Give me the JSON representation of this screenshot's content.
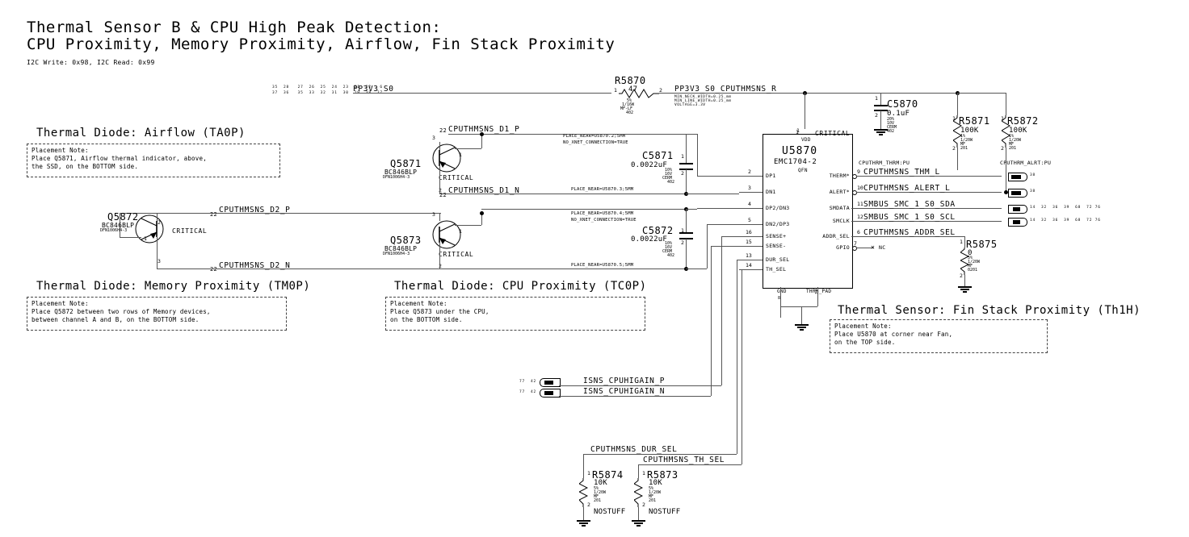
{
  "sheet": {
    "title_line1": "Thermal Sensor B & CPU High Peak Detection:",
    "title_line2": "CPU Proximity, Memory Proximity, Airflow, Fin Stack Proximity",
    "subtitle": "I2C Write: 0x98, I2C Read: 0x99"
  },
  "sections": [
    {
      "heading": "Thermal Diode: Airflow (TA0P)",
      "note": [
        "Placement Note:",
        "Place Q5871, Airflow thermal indicator, above,",
        "the SSD, on the BOTTOM side."
      ]
    },
    {
      "heading": "Thermal Diode: Memory Proximity (TM0P)",
      "note": [
        "Placement Note:",
        "Place Q5872 between two rows of Memory devices,",
        "between channel A and B, on the BOTTOM side."
      ]
    },
    {
      "heading": "Thermal Diode: CPU Proximity (TC0P)",
      "note": [
        "Placement Note:",
        "Place Q5873 under the CPU,",
        "on the BOTTOM side."
      ]
    },
    {
      "heading": "Thermal Sensor: Fin Stack Proximity (Th1H)",
      "note": [
        "Placement Note:",
        "Place U5870 at corner near Fan,",
        "on the TOP side."
      ]
    }
  ],
  "ic": {
    "ref": "U5870",
    "part": "EMC1704-2",
    "package": "QFN",
    "vdd_label": "VDD",
    "critical": "CRITICAL",
    "vdd_pin": "1",
    "gnd_label": "GND",
    "thermpad_label": "THRM_PAD",
    "gnd_pin": "8",
    "thermpad_pin": "17",
    "left_pins": [
      {
        "num": "2",
        "name": "DP1"
      },
      {
        "num": "3",
        "name": "DN1"
      },
      {
        "num": "4",
        "name": "DP2/DN3"
      },
      {
        "num": "5",
        "name": "DN2/DP3"
      },
      {
        "num": "16",
        "name": "SENSE+"
      },
      {
        "num": "15",
        "name": "SENSE-"
      },
      {
        "num": "13",
        "name": "DUR_SEL"
      },
      {
        "num": "14",
        "name": "TH_SEL"
      }
    ],
    "right_pins": [
      {
        "num": "9",
        "name": "THERM*",
        "net": "CPUTHMSNS_THM_L"
      },
      {
        "num": "10",
        "name": "ALERT*",
        "net": "CPUTHMSNS_ALERT_L"
      },
      {
        "num": "11",
        "name": "SMDATA",
        "net": "SMBUS_SMC_1_S0_SDA"
      },
      {
        "num": "12",
        "name": "SMCLK",
        "net": "SMBUS_SMC_1_S0_SCL"
      },
      {
        "num": "6",
        "name": "ADDR_SEL",
        "net": "CPUTHMSNS_ADDR_SEL"
      },
      {
        "num": "7",
        "name": "GPIO",
        "net": "NC"
      }
    ]
  },
  "components": {
    "r5870": {
      "ref": "R5870",
      "value": "47",
      "tol": "5%",
      "power": "1/16W",
      "type": "MF-LF",
      "size": "402",
      "p1": "1",
      "p2": "2"
    },
    "r5871": {
      "ref": "R5871",
      "value": "100K",
      "tol": "1%",
      "power": "1/20W",
      "type": "MF",
      "size": "201",
      "p1": "1",
      "p2": "2"
    },
    "r5872": {
      "ref": "R5872",
      "value": "100K",
      "tol": "1%",
      "power": "1/20W",
      "type": "MF",
      "size": "201",
      "p1": "1",
      "p2": "2"
    },
    "r5873": {
      "ref": "R5873",
      "value": "10K",
      "tol": "5%",
      "power": "1/20W",
      "type": "MF",
      "size": "201",
      "p1": "1",
      "p2": "2",
      "stuff": "NOSTUFF"
    },
    "r5874": {
      "ref": "R5874",
      "value": "10K",
      "tol": "5%",
      "power": "1/20W",
      "type": "MF",
      "size": "201",
      "p1": "1",
      "p2": "2",
      "stuff": "NOSTUFF"
    },
    "r5875": {
      "ref": "R5875",
      "value": "0",
      "tol": "5%",
      "power": "1/20W",
      "type": "MF",
      "size": "0201",
      "p1": "1",
      "p2": "2"
    },
    "c5870": {
      "ref": "C5870",
      "value": "0.1uF",
      "tol": "20%",
      "volt": "10V",
      "type": "CERM",
      "size": "402",
      "p1": "1",
      "p2": "2"
    },
    "c5871": {
      "ref": "C5871",
      "value": "0.0022uF",
      "tol": "10%",
      "volt": "16V",
      "type": "CERM",
      "size": "402",
      "p1": "1",
      "p2": "2"
    },
    "c5872": {
      "ref": "C5872",
      "value": "0.0022uF",
      "tol": "10%",
      "volt": "16V",
      "type": "CERM",
      "size": "402",
      "p1": "1",
      "p2": "2"
    },
    "q5871": {
      "ref": "Q5871",
      "part": "BC846BLP",
      "package": "DFN1006H4-3",
      "critical": "CRITICAL",
      "p1": "1",
      "p2": "2",
      "p3": "3"
    },
    "q5872": {
      "ref": "Q5872",
      "part": "BC846BLP",
      "package": "DFN1006H4-3",
      "critical": "CRITICAL",
      "p1": "1",
      "p2": "2",
      "p3": "3"
    },
    "q5873": {
      "ref": "Q5873",
      "part": "BC846BLP",
      "package": "DFN1006H4-3",
      "critical": "CRITICAL",
      "p1": "1",
      "p2": "2",
      "p3": "3"
    }
  },
  "nets": {
    "pp3v3_s0": "PP3V3_S0",
    "pp3v3_s0_cputhmsns_r": "PP3V3_S0_CPUTHMSNS_R",
    "netclass_a": "MIN_NECK_WIDTH=0.25_mm",
    "netclass_b": "MIN_LINE_WIDTH=0.25_mm",
    "netclass_c": "VOLTAGE=3.3V",
    "d1_p": "CPUTHMSNS_D1_P",
    "d1_n": "CPUTHMSNS_D1_N",
    "d2_p": "CPUTHMSNS_D2_P",
    "d2_n": "CPUTHMSNS_D2_N",
    "isns_p": "ISNS_CPUHIGAIN_P",
    "isns_n": "ISNS_CPUHIGAIN_N",
    "dur_sel": "CPUTHMSNS_DUR_SEL",
    "th_sel": "CPUTHMSNS_TH_SEL",
    "cputhrm_thrm_pu": "CPUTHRM_THRM:PU",
    "cputhrm_alrt_pu": "CPUTHRM_ALRT:PU"
  },
  "place_near": [
    "PLACE_NEAR=U5870.2;5MM",
    "NO_XNET_CONNECTION=TRUE",
    "PLACE_NEAR=U5870.3;5MM",
    "PLACE_NEAR=U5870.4;5MM",
    "NO_XNET_CONNECTION=TRUE",
    "PLACE_NEAR=U5870.5;5MM"
  ],
  "offpage_refs": {
    "pp3v3_top_row1": "35  28   27  26  25  24  23  21  22   6",
    "pp3v3_top_row2": "37  36   35  33  32  31  30  29  38  37",
    "isns_ref": "77  42",
    "thm_ref": "38",
    "alrt_ref": "38",
    "sda_ref": "14  32  36  39  68  72 76",
    "scl_ref": "14  32  36  39  68  72 76",
    "d1p_ref": "22",
    "d1n_ref": "22",
    "d2p_ref": "22",
    "d2n_ref": "22"
  }
}
